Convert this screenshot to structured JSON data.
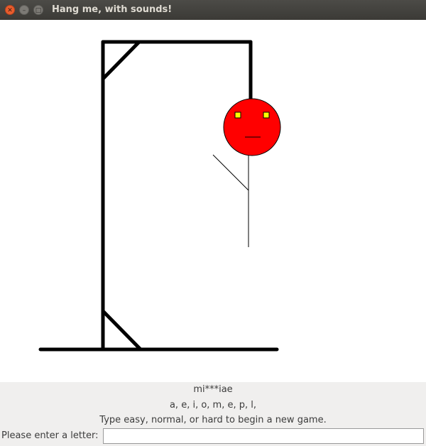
{
  "window": {
    "title": "Hang me, with sounds!",
    "close_glyph": "✕",
    "minimize_glyph": "–",
    "maximize_glyph": "□"
  },
  "game": {
    "masked_word": "mi***iae",
    "guessed_letters": "a, e, i, o, m, e, p, l,",
    "instructions": "Type easy, normal, or hard to begin a new game.",
    "prompt_label": "Please enter a letter:",
    "input_value": ""
  },
  "drawing": {
    "head_color": "#ff0000",
    "eye_color": "#ffff00",
    "line_color": "#000000"
  }
}
